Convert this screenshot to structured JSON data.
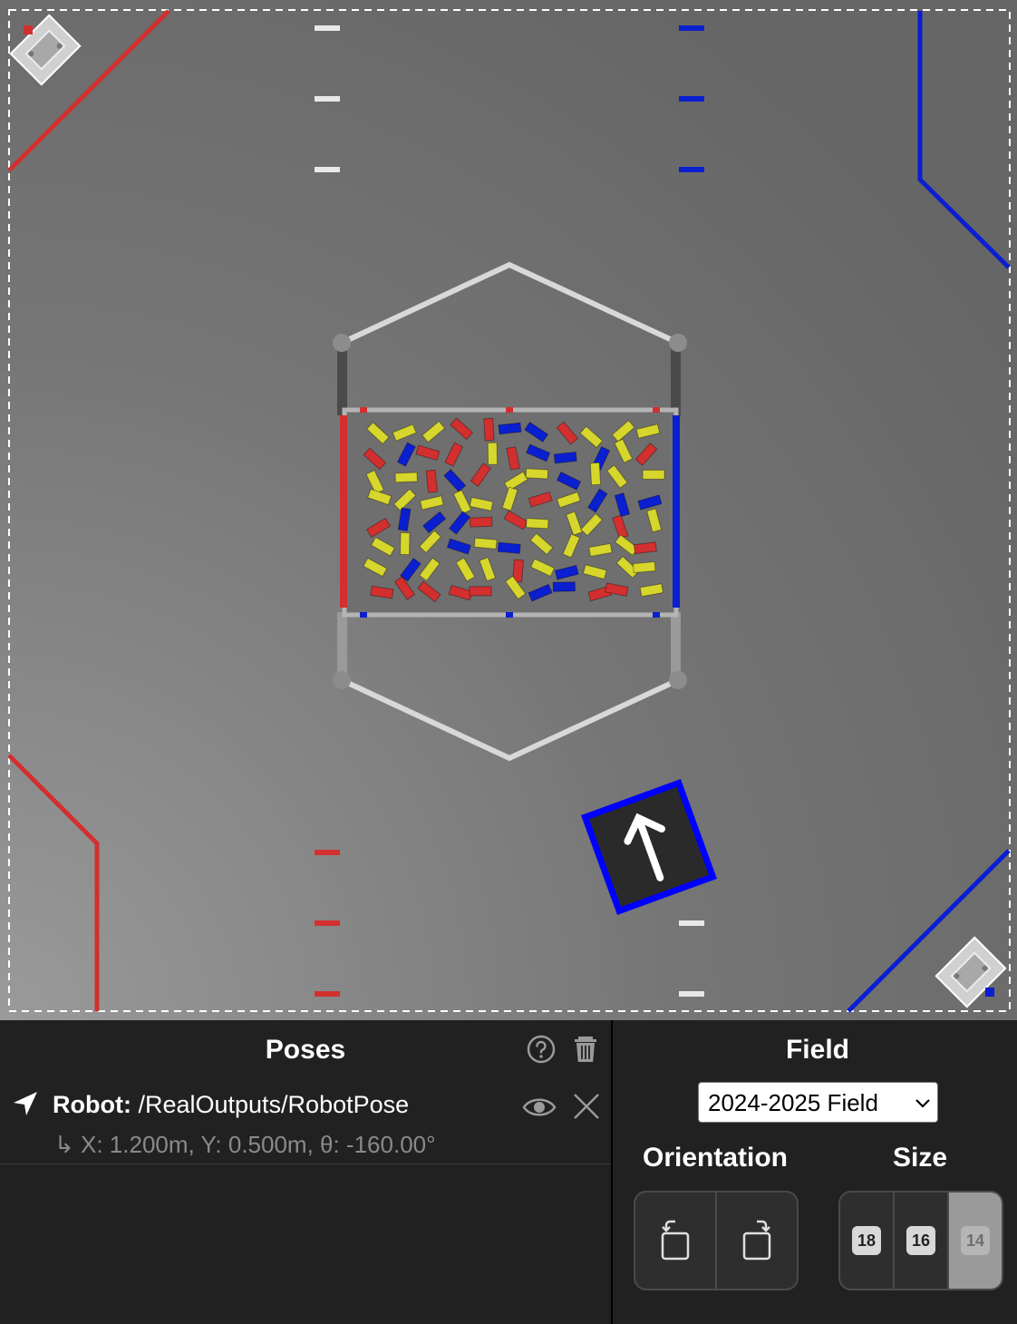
{
  "field": {
    "corner_labels": [
      "18",
      "16",
      "14"
    ]
  },
  "poses": {
    "title": "Poses",
    "help_icon": "help-circle-icon",
    "trash_icon": "trash-icon",
    "items": [
      {
        "type_label": "Robot:",
        "source": " /RealOutputs/RobotPose",
        "detail": "X: 1.200m, Y: 0.500m, θ: -160.00°",
        "icon": "navigation-arrow-icon"
      }
    ]
  },
  "field_panel": {
    "title": "Field",
    "selected_field": "2024-2025 Field",
    "orientation_label": "Orientation",
    "size_label": "Size",
    "sizes": [
      "18",
      "16",
      "14"
    ],
    "active_size": "14"
  },
  "colors": {
    "red_alliance": "#d32f2f",
    "blue_alliance": "#0a1fd0",
    "sample_yellow": "#d6d62c",
    "panel_bg": "#212121"
  }
}
